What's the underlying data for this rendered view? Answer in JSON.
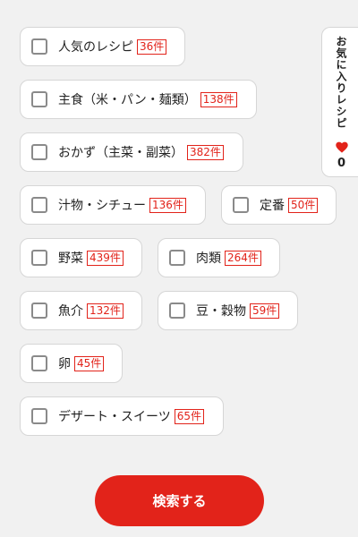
{
  "categories": [
    {
      "label": "人気のレシピ",
      "count": "36件"
    },
    {
      "label": "主食（米・パン・麺類）",
      "count": "138件"
    },
    {
      "label": "おかず（主菜・副菜）",
      "count": "382件"
    },
    {
      "label": "汁物・シチュー",
      "count": "136件"
    },
    {
      "label": "定番",
      "count": "50件"
    },
    {
      "label": "野菜",
      "count": "439件"
    },
    {
      "label": "肉類",
      "count": "264件"
    },
    {
      "label": "魚介",
      "count": "132件"
    },
    {
      "label": "豆・穀物",
      "count": "59件"
    },
    {
      "label": "卵",
      "count": "45件"
    },
    {
      "label": "デザート・スイーツ",
      "count": "65件"
    }
  ],
  "favorites": {
    "label": "お気に入りレシピ",
    "count": "0",
    "icon": "heart-icon"
  },
  "search": {
    "label": "検索する"
  },
  "colors": {
    "accent": "#e2231a",
    "background": "#f1f1f1",
    "chip": "#ffffff",
    "checkbox_border": "#8a8a8a"
  }
}
